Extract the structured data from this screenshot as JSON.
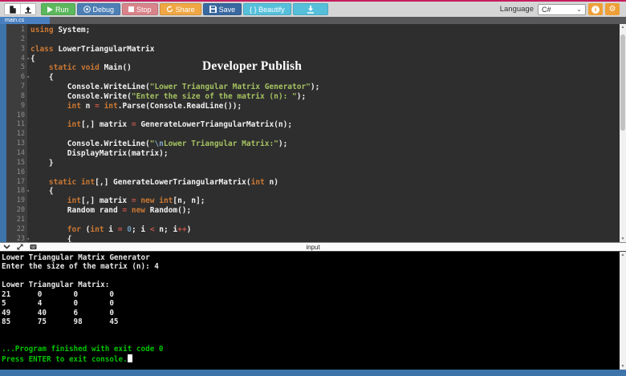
{
  "app": {
    "top_accent_color": "#c41d5e",
    "frame_color": "#3d74a9"
  },
  "toolbar": {
    "run": "Run",
    "debug": "Debug",
    "stop": "Stop",
    "share": "Share",
    "save": "Save",
    "beautify": "{ } Beautify",
    "language_label": "Language",
    "language_value": "C#",
    "info_glyph": "i",
    "gear_glyph": "⚙"
  },
  "tabs": {
    "active": "main.cs"
  },
  "editor": {
    "watermark": "Developer Publish",
    "fold_lines": [
      4,
      6,
      18,
      23
    ],
    "token_colors": {
      "keyword": "#cc7833",
      "string": "#a5c261",
      "number": "#6c99bb",
      "operator": "#c9574a",
      "escape": "#84a7c6",
      "plain": "#f2f2f2"
    },
    "lines": [
      [
        [
          "k",
          "using"
        ],
        [
          "p",
          " System;"
        ]
      ],
      [],
      [
        [
          "k",
          "class"
        ],
        [
          "p",
          " LowerTriangularMatrix"
        ]
      ],
      [
        [
          "p",
          "{"
        ]
      ],
      [
        [
          "p",
          "    "
        ],
        [
          "k",
          "static"
        ],
        [
          "p",
          " "
        ],
        [
          "k",
          "void"
        ],
        [
          "p",
          " Main()"
        ]
      ],
      [
        [
          "p",
          "    {"
        ]
      ],
      [
        [
          "p",
          "        Console.WriteLine("
        ],
        [
          "s",
          "\"Lower Triangular Matrix Generator\""
        ],
        [
          "p",
          ");"
        ]
      ],
      [
        [
          "p",
          "        Console.Write("
        ],
        [
          "s",
          "\"Enter the size of the matrix (n): \""
        ],
        [
          "p",
          ");"
        ]
      ],
      [
        [
          "p",
          "        "
        ],
        [
          "k",
          "int"
        ],
        [
          "p",
          " n "
        ],
        [
          "o",
          "="
        ],
        [
          "p",
          " "
        ],
        [
          "k",
          "int"
        ],
        [
          "p",
          ".Parse(Console.ReadLine());"
        ]
      ],
      [],
      [
        [
          "p",
          "        "
        ],
        [
          "k",
          "int"
        ],
        [
          "p",
          "[,] matrix "
        ],
        [
          "o",
          "="
        ],
        [
          "p",
          " GenerateLowerTriangularMatrix(n);"
        ]
      ],
      [],
      [
        [
          "p",
          "        Console.WriteLine("
        ],
        [
          "s",
          "\""
        ],
        [
          "e",
          "\\n"
        ],
        [
          "s",
          "Lower Triangular Matrix:\""
        ],
        [
          "p",
          ");"
        ]
      ],
      [
        [
          "p",
          "        DisplayMatrix(matrix);"
        ]
      ],
      [
        [
          "p",
          "    }"
        ]
      ],
      [],
      [
        [
          "p",
          "    "
        ],
        [
          "k",
          "static"
        ],
        [
          "p",
          " "
        ],
        [
          "k",
          "int"
        ],
        [
          "p",
          "[,] GenerateLowerTriangularMatrix("
        ],
        [
          "k",
          "int"
        ],
        [
          "p",
          " n)"
        ]
      ],
      [
        [
          "p",
          "    {"
        ]
      ],
      [
        [
          "p",
          "        "
        ],
        [
          "k",
          "int"
        ],
        [
          "p",
          "[,] matrix "
        ],
        [
          "o",
          "="
        ],
        [
          "p",
          " "
        ],
        [
          "k",
          "new"
        ],
        [
          "p",
          " "
        ],
        [
          "k",
          "int"
        ],
        [
          "p",
          "[n, n];"
        ]
      ],
      [
        [
          "p",
          "        Random rand "
        ],
        [
          "o",
          "="
        ],
        [
          "p",
          " "
        ],
        [
          "k",
          "new"
        ],
        [
          "p",
          " Random();"
        ]
      ],
      [],
      [
        [
          "p",
          "        "
        ],
        [
          "k",
          "for"
        ],
        [
          "p",
          " ("
        ],
        [
          "k",
          "int"
        ],
        [
          "p",
          " i "
        ],
        [
          "o",
          "="
        ],
        [
          "p",
          " "
        ],
        [
          "n",
          "0"
        ],
        [
          "p",
          "; i "
        ],
        [
          "o",
          "<"
        ],
        [
          "p",
          " n; i"
        ],
        [
          "o",
          "++"
        ],
        [
          "p",
          ")"
        ]
      ],
      [
        [
          "p",
          "        {"
        ]
      ]
    ]
  },
  "console_panel": {
    "input_label": "input",
    "output_color": "#e8e8e8",
    "status_color": "#00c400",
    "lines": [
      {
        "kind": "out",
        "text": "Lower Triangular Matrix Generator"
      },
      {
        "kind": "out",
        "text": "Enter the size of the matrix (n): 4"
      },
      {
        "kind": "out",
        "text": ""
      },
      {
        "kind": "out",
        "text": "Lower Triangular Matrix:"
      },
      {
        "kind": "out",
        "text": "21      0       0       0"
      },
      {
        "kind": "out",
        "text": "5       4       0       0"
      },
      {
        "kind": "out",
        "text": "49      40      6       0"
      },
      {
        "kind": "out",
        "text": "85      75      98      45"
      },
      {
        "kind": "out",
        "text": ""
      },
      {
        "kind": "out",
        "text": ""
      },
      {
        "kind": "ok",
        "text": "...Program finished with exit code 0"
      },
      {
        "kind": "ok",
        "text": "Press ENTER to exit console.",
        "cursor": true
      }
    ]
  }
}
